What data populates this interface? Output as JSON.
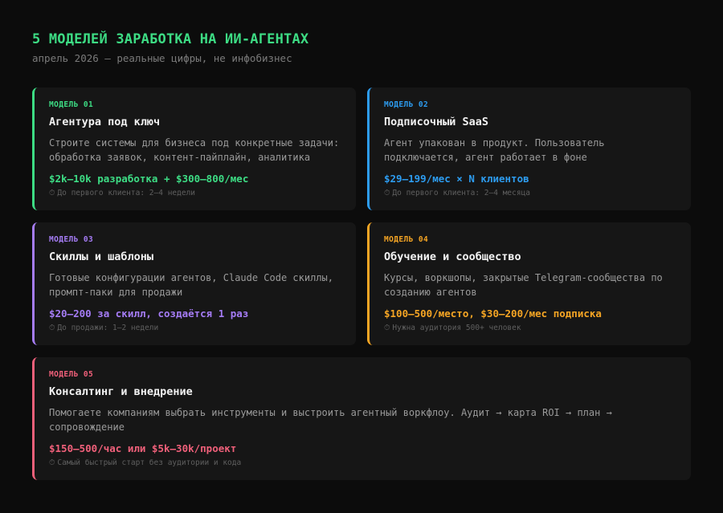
{
  "header": {
    "title": "5 МОДЕЛЕЙ ЗАРАБОТКА НА ИИ-АГЕНТАХ",
    "subtitle": "апрель 2026 — реальные цифры, не инфобизнес",
    "title_color": "#3ddc84"
  },
  "clock_icon": "⏱",
  "models": [
    {
      "label": "МОДЕЛЬ 01",
      "name": "Агентура под ключ",
      "description": "Строите системы для бизнеса под конкретные задачи: обработка заявок, контент-пайплайн, аналитика",
      "price": "$2k–10k разработка + $300–800/мес",
      "note": "До первого клиента: 2–4 недели",
      "color": "#3ddc84"
    },
    {
      "label": "МОДЕЛЬ 02",
      "name": "Подписочный SaaS",
      "description": "Агент упакован в продукт. Пользователь подключается, агент работает в фоне",
      "price": "$29–199/мес × N клиентов",
      "note": "До первого клиента: 2–4 месяца",
      "color": "#2d9cf0"
    },
    {
      "label": "МОДЕЛЬ 03",
      "name": "Скиллы и шаблоны",
      "description": "Готовые конфигурации агентов, Claude Code скиллы, промпт-паки для продажи",
      "price": "$20–200 за скилл, создаётся 1 раз",
      "note": "До продажи: 1–2 недели",
      "color": "#a57cf5"
    },
    {
      "label": "МОДЕЛЬ 04",
      "name": "Обучение и сообщество",
      "description": "Курсы, воркшопы, закрытые Telegram-сообщества по созданию агентов",
      "price": "$100–500/место, $30–200/мес подписка",
      "note": "Нужна аудитория 500+ человек",
      "color": "#f5a524"
    },
    {
      "label": "МОДЕЛЬ 05",
      "name": "Консалтинг и внедрение",
      "description": "Помогаете компаниям выбрать инструменты и выстроить агентный воркфлоу. Аудит → карта ROI → план → сопровождение",
      "price": "$150–500/час или $5k–30k/проект",
      "note": "Самый быстрый старт без аудитории и кода",
      "color": "#f0607a"
    }
  ]
}
